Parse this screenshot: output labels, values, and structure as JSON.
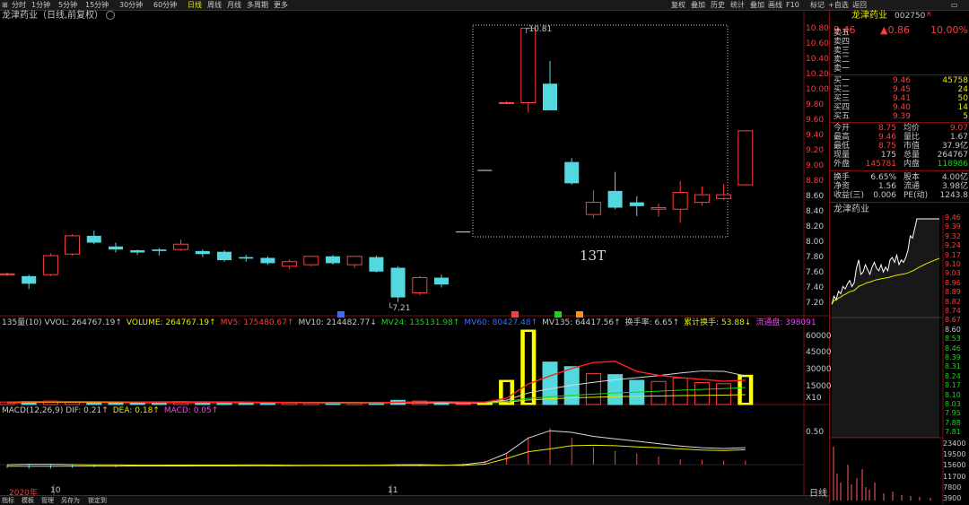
{
  "toolbar": {
    "left_items": [
      "分时",
      "1分钟",
      "5分钟",
      "15分钟",
      "30分钟",
      "60分钟",
      "日线",
      "周线",
      "月线",
      "多周期",
      "更多"
    ],
    "right_items": [
      "叠加",
      "画线",
      "F10",
      "标记",
      "+自选",
      "返回"
    ],
    "right_left_items": [
      "复权",
      "叠加",
      "历史",
      "统计"
    ]
  },
  "chart_title": "龙津药业（日线,前复权）",
  "annotations": {
    "high_label": "10.81",
    "low_label": "7.21",
    "box_label": "13T"
  },
  "price_axis": [
    "10.80",
    "10.60",
    "10.40",
    "10.20",
    "10.00",
    "9.80",
    "9.60",
    "9.40",
    "9.20",
    "9.00",
    "8.80",
    "8.60",
    "8.40",
    "8.20",
    "8.00",
    "7.80",
    "7.60",
    "7.40",
    "7.20"
  ],
  "volume_legend": [
    {
      "text": "135量(10) VVOL: 264767.19↑",
      "color": "#c8c8c8"
    },
    {
      "text": "VOLUME: 264767.19↑",
      "color": "#e8e800"
    },
    {
      "text": "MV5: 175480.67↑",
      "color": "#ff3c3c"
    },
    {
      "text": "MV10: 214482.77↓",
      "color": "#c8c8c8"
    },
    {
      "text": "MV24: 135131.98↑",
      "color": "#17d417"
    },
    {
      "text": "MV60: 80427.48↑",
      "color": "#3c6cff"
    },
    {
      "text": "MV135: 64417.56↑",
      "color": "#c8c8c8"
    },
    {
      "text": "换手率: 6.65↑",
      "color": "#c8c8c8"
    },
    {
      "text": "累计换手: 53.88↓",
      "color": "#e8e800"
    },
    {
      "text": "流通盘: 398091",
      "color": "#ff3cff"
    }
  ],
  "volume_axis": [
    "60000",
    "45000",
    "30000",
    "15000",
    "X10"
  ],
  "macd_legend": [
    {
      "text": "MACD(12,26,9) DIF: 0.21↑",
      "color": "#c8c8c8"
    },
    {
      "text": "DEA: 0.18↑",
      "color": "#e8e800"
    },
    {
      "text": "MACD: 0.05↑",
      "color": "#ff3cff"
    }
  ],
  "macd_axis": [
    "0.50"
  ],
  "x_labels": {
    "left": "2020年",
    "oct": "10",
    "nov": "11"
  },
  "bottom_tabs": [
    "指标",
    "模板",
    "管理",
    "另存为",
    "锁定到"
  ],
  "bottom_right": "日线",
  "quote": {
    "name": "龙津药业",
    "code": "002750",
    "suffix": "R",
    "price": "9.46",
    "change": "▲0.86",
    "pct": "10.00%",
    "asks": [
      {
        "label": "卖五",
        "price": "",
        "vol": ""
      },
      {
        "label": "卖四",
        "price": "",
        "vol": ""
      },
      {
        "label": "卖三",
        "price": "",
        "vol": ""
      },
      {
        "label": "卖二",
        "price": "",
        "vol": ""
      },
      {
        "label": "卖一",
        "price": "",
        "vol": ""
      }
    ],
    "bids": [
      {
        "label": "买一",
        "price": "9.46",
        "vol": "45758"
      },
      {
        "label": "买二",
        "price": "9.45",
        "vol": "24"
      },
      {
        "label": "买三",
        "price": "9.41",
        "vol": "50"
      },
      {
        "label": "买四",
        "price": "9.40",
        "vol": "14"
      },
      {
        "label": "买五",
        "price": "9.39",
        "vol": "5"
      }
    ],
    "stats": [
      {
        "l1": "今开",
        "v1": "8.75",
        "l2": "均价",
        "v2": "9.07"
      },
      {
        "l1": "最高",
        "v1": "9.46",
        "l2": "量比",
        "v2": "1.67"
      },
      {
        "l1": "最低",
        "v1": "8.75",
        "l2": "市值",
        "v2": "37.9亿"
      },
      {
        "l1": "现量",
        "v1": "175",
        "l2": "总量",
        "v2": "264767"
      },
      {
        "l1": "外盘",
        "v1": "145781",
        "l2": "内盘",
        "v2": "118986"
      }
    ],
    "stats2": [
      {
        "l1": "换手",
        "v1": "6.65%",
        "l2": "股本",
        "v2": "4.00亿"
      },
      {
        "l1": "净资",
        "v1": "1.56",
        "l2": "流通",
        "v2": "3.98亿"
      },
      {
        "l1": "收益(三)",
        "v1": "0.006",
        "l2": "PE(动)",
        "v2": "1243.8"
      }
    ],
    "mini_title": "龙津药业",
    "mini_price_axis": [
      "9.46",
      "9.39",
      "9.32",
      "9.24",
      "9.17",
      "9.10",
      "9.03",
      "8.96",
      "8.89",
      "8.82",
      "8.74",
      "8.67",
      "8.60",
      "8.53",
      "8.46",
      "8.39",
      "8.31",
      "8.24",
      "8.17",
      "8.10",
      "8.03",
      "7.95",
      "7.88",
      "7.81"
    ],
    "mini_vol_axis": [
      "23400",
      "19500",
      "15600",
      "11700",
      "7800",
      "3900"
    ]
  },
  "chart_data": {
    "type": "candlestick",
    "ylim": [
      7.1,
      10.85
    ],
    "candles": [
      {
        "o": 7.57,
        "c": 7.58,
        "h": 7.6,
        "l": 7.55
      },
      {
        "o": 7.55,
        "c": 7.45,
        "h": 7.57,
        "l": 7.38
      },
      {
        "o": 7.57,
        "c": 7.82,
        "h": 7.85,
        "l": 7.55
      },
      {
        "o": 7.84,
        "c": 8.08,
        "h": 8.1,
        "l": 7.82
      },
      {
        "o": 8.08,
        "c": 7.99,
        "h": 8.15,
        "l": 7.97
      },
      {
        "o": 7.94,
        "c": 7.9,
        "h": 7.99,
        "l": 7.86
      },
      {
        "o": 7.89,
        "c": 7.86,
        "h": 7.9,
        "l": 7.83
      },
      {
        "o": 7.9,
        "c": 7.88,
        "h": 7.92,
        "l": 7.82
      },
      {
        "o": 7.9,
        "c": 7.97,
        "h": 8.03,
        "l": 7.88
      },
      {
        "o": 7.88,
        "c": 7.84,
        "h": 7.9,
        "l": 7.8
      },
      {
        "o": 7.87,
        "c": 7.76,
        "h": 7.89,
        "l": 7.74
      },
      {
        "o": 7.8,
        "c": 7.78,
        "h": 7.83,
        "l": 7.74
      },
      {
        "o": 7.79,
        "c": 7.72,
        "h": 7.81,
        "l": 7.7
      },
      {
        "o": 7.68,
        "c": 7.74,
        "h": 7.77,
        "l": 7.64
      },
      {
        "o": 7.7,
        "c": 7.81,
        "h": 7.82,
        "l": 7.68
      },
      {
        "o": 7.81,
        "c": 7.72,
        "h": 7.83,
        "l": 7.7
      },
      {
        "o": 7.7,
        "c": 7.81,
        "h": 7.82,
        "l": 7.66
      },
      {
        "o": 7.8,
        "c": 7.61,
        "h": 7.82,
        "l": 7.6
      },
      {
        "o": 7.66,
        "c": 7.27,
        "h": 7.68,
        "l": 7.21
      },
      {
        "o": 7.33,
        "c": 7.53,
        "h": 7.55,
        "l": 7.3
      },
      {
        "o": 7.53,
        "c": 7.44,
        "h": 7.57,
        "l": 7.4
      },
      {
        "o": 8.13,
        "c": 8.13,
        "h": 8.13,
        "l": 8.13
      },
      {
        "o": 8.94,
        "c": 8.94,
        "h": 8.94,
        "l": 8.94
      },
      {
        "o": 9.83,
        "c": 9.83,
        "h": 9.85,
        "l": 9.81
      },
      {
        "o": 9.83,
        "c": 10.81,
        "h": 10.81,
        "l": 9.7
      },
      {
        "o": 10.08,
        "c": 9.73,
        "h": 10.38,
        "l": 9.73
      },
      {
        "o": 9.05,
        "c": 8.77,
        "h": 9.1,
        "l": 8.75
      },
      {
        "o": 8.36,
        "c": 8.52,
        "h": 8.68,
        "l": 8.32
      },
      {
        "o": 8.67,
        "c": 8.45,
        "h": 8.92,
        "l": 8.43
      },
      {
        "o": 8.52,
        "c": 8.47,
        "h": 8.6,
        "l": 8.34
      },
      {
        "o": 8.43,
        "c": 8.45,
        "h": 8.5,
        "l": 8.33
      },
      {
        "o": 8.43,
        "c": 8.65,
        "h": 8.8,
        "l": 8.25
      },
      {
        "o": 8.52,
        "c": 8.62,
        "h": 8.73,
        "l": 8.48
      },
      {
        "o": 8.57,
        "c": 8.62,
        "h": 8.76,
        "l": 8.55
      },
      {
        "o": 8.75,
        "c": 9.46,
        "h": 9.46,
        "l": 8.75
      }
    ],
    "volume": [
      3000,
      3500,
      3800,
      3200,
      2800,
      2500,
      2600,
      2400,
      3200,
      2800,
      2600,
      2400,
      2300,
      2200,
      2300,
      2400,
      2300,
      2600,
      4500,
      3800,
      2700,
      1500,
      1800,
      22000,
      66000,
      38000,
      34000,
      28000,
      27000,
      22000,
      21000,
      24000,
      20000,
      19000,
      26476
    ],
    "macd_hist": [
      -0.04,
      -0.05,
      -0.05,
      -0.04,
      -0.03,
      -0.03,
      -0.02,
      -0.02,
      -0.02,
      -0.02,
      -0.02,
      -0.02,
      -0.02,
      -0.01,
      -0.01,
      -0.01,
      -0.01,
      -0.01,
      -0.02,
      -0.02,
      -0.01,
      0.02,
      0.05,
      0.13,
      0.34,
      0.45,
      0.33,
      0.22,
      0.17,
      0.14,
      0.1,
      0.07,
      0.06,
      0.05,
      0.05
    ]
  }
}
